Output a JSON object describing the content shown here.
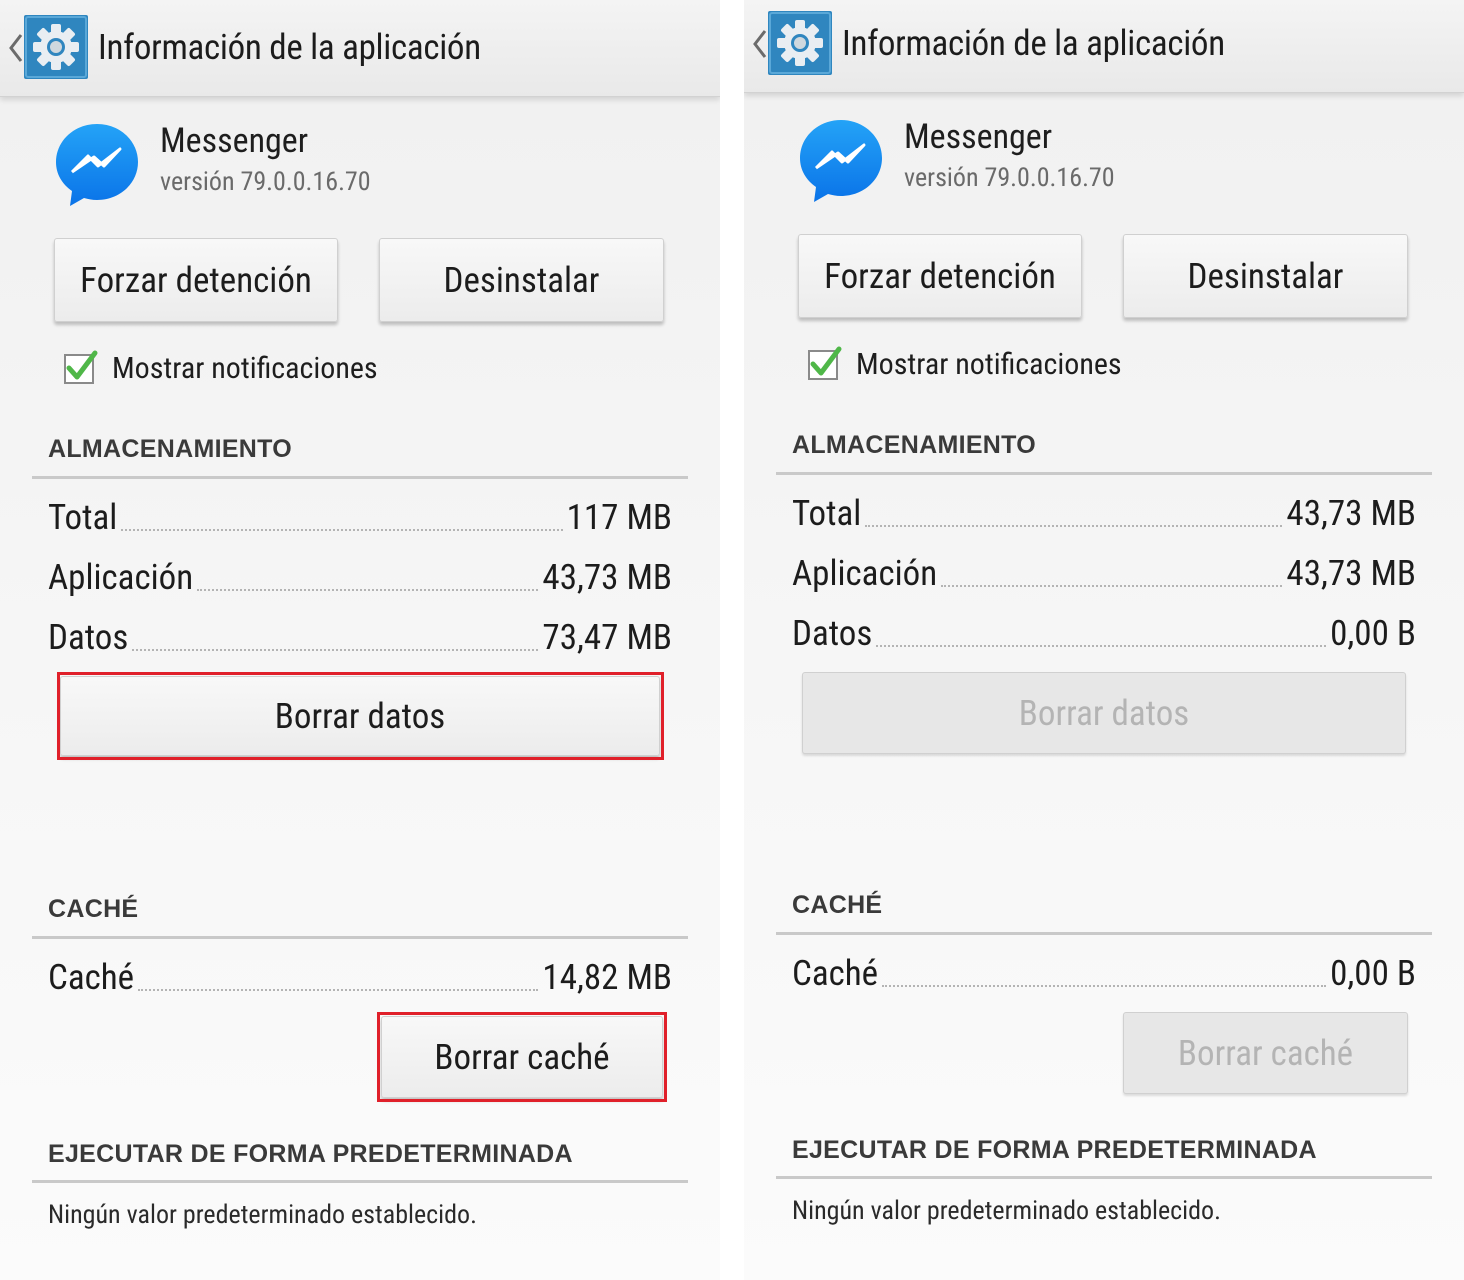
{
  "screens": [
    {
      "action_bar": {
        "title": "Información de la aplicación",
        "back_icon": "chevron-left-icon",
        "app_icon": "settings-gear-icon"
      },
      "app": {
        "name": "Messenger",
        "version": "versión 79.0.0.16.70",
        "icon": "messenger-icon"
      },
      "buttons": {
        "force_stop": "Forzar detención",
        "uninstall": "Desinstalar"
      },
      "notifications": {
        "label": "Mostrar notificaciones",
        "checked": true
      },
      "storage": {
        "header": "ALMACENAMIENTO",
        "rows": [
          {
            "label": "Total",
            "value": "117 MB"
          },
          {
            "label": "Aplicación",
            "value": "43,73 MB"
          },
          {
            "label": "Datos",
            "value": "73,47 MB"
          }
        ],
        "clear_data": "Borrar datos",
        "clear_data_enabled": true
      },
      "cache": {
        "header": "CACHÉ",
        "row": {
          "label": "Caché",
          "value": "14,82 MB"
        },
        "clear_cache": "Borrar caché",
        "clear_cache_enabled": true
      },
      "defaults": {
        "header": "EJECUTAR DE FORMA PREDETERMINADA",
        "text": "Ningún valor predeterminado establecido."
      },
      "highlight_color": "#e0202a"
    },
    {
      "action_bar": {
        "title": "Información de la aplicación",
        "back_icon": "chevron-left-icon",
        "app_icon": "settings-gear-icon"
      },
      "app": {
        "name": "Messenger",
        "version": "versión 79.0.0.16.70",
        "icon": "messenger-icon"
      },
      "buttons": {
        "force_stop": "Forzar detención",
        "uninstall": "Desinstalar"
      },
      "notifications": {
        "label": "Mostrar notificaciones",
        "checked": true
      },
      "storage": {
        "header": "ALMACENAMIENTO",
        "rows": [
          {
            "label": "Total",
            "value": "43,73 MB"
          },
          {
            "label": "Aplicación",
            "value": "43,73 MB"
          },
          {
            "label": "Datos",
            "value": "0,00 B"
          }
        ],
        "clear_data": "Borrar datos",
        "clear_data_enabled": false
      },
      "cache": {
        "header": "CACHÉ",
        "row": {
          "label": "Caché",
          "value": "0,00 B"
        },
        "clear_cache": "Borrar caché",
        "clear_cache_enabled": false
      },
      "defaults": {
        "header": "EJECUTAR DE FORMA PREDETERMINADA",
        "text": "Ningún valor predeterminado establecido."
      }
    }
  ]
}
